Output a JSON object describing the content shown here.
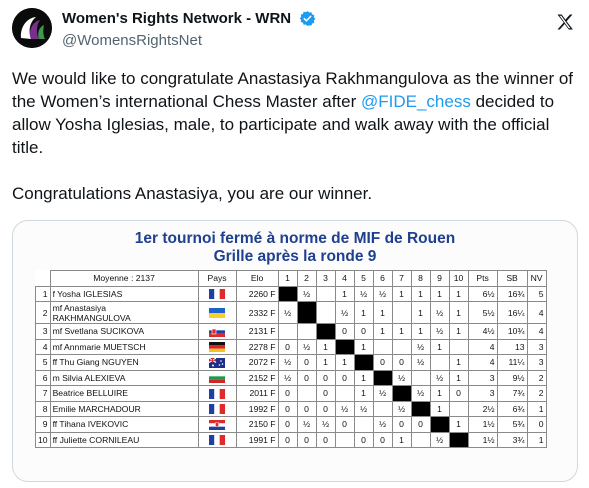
{
  "header": {
    "display_name": "Women's Rights Network - WRN",
    "handle": "@WomensRightsNet"
  },
  "tweet": {
    "text_before_mention": "We would like to congratulate Anastasiya Rakhmangulova as the winner of the Women’s international Chess Master after ",
    "mention": "@FIDE_chess",
    "text_after_mention": " decided to allow Yosha Iglesias, male, to participate and walk away with the official title.\n\nCongratulations Anastasiya, you are our winner."
  },
  "media": {
    "title_line1": "1er tournoi fermé à norme de MIF de Rouen",
    "title_line2": "Grille après la ronde 9",
    "table": {
      "header": {
        "moyenne": "Moyenne : 2137",
        "pays": "Pays",
        "elo": "Elo",
        "rounds": [
          "1",
          "2",
          "3",
          "4",
          "5",
          "6",
          "7",
          "8",
          "9",
          "10"
        ],
        "pts": "Pts",
        "sb": "SB",
        "nv": "NV"
      },
      "rows": [
        {
          "rank": "1",
          "name": "f Yosha IGLESIAS",
          "name2": "",
          "flag": "fr",
          "elo": "2260 F",
          "cells": [
            "",
            "½",
            "",
            "1",
            "½",
            "½",
            "1",
            "1",
            "1",
            "1"
          ],
          "pts": "6½",
          "sb": "16¾",
          "nv": "5"
        },
        {
          "rank": "2",
          "name": "mf Anastasiya",
          "name2": "RAKHMANGULOVA",
          "flag": "ua",
          "elo": "2332 F",
          "cells": [
            "½",
            "",
            "",
            "½",
            "1",
            "1",
            "",
            "1",
            "½",
            "1"
          ],
          "pts": "5½",
          "sb": "16¼",
          "nv": "4"
        },
        {
          "rank": "3",
          "name": "mf Svetlana SUCIKOVA",
          "name2": "",
          "flag": "sk",
          "elo": "2131 F",
          "cells": [
            "",
            "",
            "",
            "0",
            "0",
            "1",
            "1",
            "1",
            "½",
            "1"
          ],
          "pts": "4½",
          "sb": "10¾",
          "nv": "4"
        },
        {
          "rank": "4",
          "name": "mf Annmarie MUETSCH",
          "name2": "",
          "flag": "de",
          "elo": "2278 F",
          "cells": [
            "0",
            "½",
            "1",
            "",
            "1",
            "",
            "",
            "½",
            "1",
            ""
          ],
          "pts": "4",
          "sb": "13",
          "nv": "3"
        },
        {
          "rank": "5",
          "name": "ff Thu Giang NGUYEN",
          "name2": "",
          "flag": "au",
          "elo": "2072 F",
          "cells": [
            "½",
            "0",
            "1",
            "1",
            "",
            "0",
            "0",
            "½",
            "",
            "1"
          ],
          "pts": "4",
          "sb": "11¼",
          "nv": "3"
        },
        {
          "rank": "6",
          "name": "m Silvia ALEXIEVA",
          "name2": "",
          "flag": "bg",
          "elo": "2152 F",
          "cells": [
            "½",
            "0",
            "0",
            "0",
            "1",
            "",
            "½",
            "",
            "½",
            "1"
          ],
          "pts": "3",
          "sb": "9½",
          "nv": "2"
        },
        {
          "rank": "7",
          "name": "Beatrice BELLUIRE",
          "name2": "",
          "flag": "fr",
          "elo": "2011 F",
          "cells": [
            "0",
            "",
            "0",
            "",
            "1",
            "½",
            "",
            "½",
            "1",
            "0"
          ],
          "pts": "3",
          "sb": "7¾",
          "nv": "2"
        },
        {
          "rank": "8",
          "name": "Emilie MARCHADOUR",
          "name2": "",
          "flag": "fr",
          "elo": "1992 F",
          "cells": [
            "0",
            "0",
            "0",
            "½",
            "½",
            "",
            "½",
            "",
            "1",
            ""
          ],
          "pts": "2½",
          "sb": "6¾",
          "nv": "1"
        },
        {
          "rank": "9",
          "name": "ff Tihana IVEKOVIC",
          "name2": "",
          "flag": "hr",
          "elo": "2150 F",
          "cells": [
            "0",
            "½",
            "½",
            "0",
            "",
            "½",
            "0",
            "0",
            "",
            "1"
          ],
          "pts": "1½",
          "sb": "5¾",
          "nv": "0"
        },
        {
          "rank": "10",
          "name": "ff Juliette CORNILEAU",
          "name2": "",
          "flag": "fr",
          "elo": "1991 F",
          "cells": [
            "0",
            "0",
            "0",
            "",
            "0",
            "0",
            "1",
            "",
            "½",
            ""
          ],
          "pts": "1½",
          "sb": "3¾",
          "nv": "1"
        }
      ]
    }
  },
  "icons": {
    "verified": "verified-badge-icon",
    "x_logo": "x-logo-icon",
    "avatar": "wrn-logo-avatar"
  },
  "colors": {
    "link": "#1d9bf0",
    "verified": "#1d9bf0",
    "table_title": "#1f3f8f"
  }
}
